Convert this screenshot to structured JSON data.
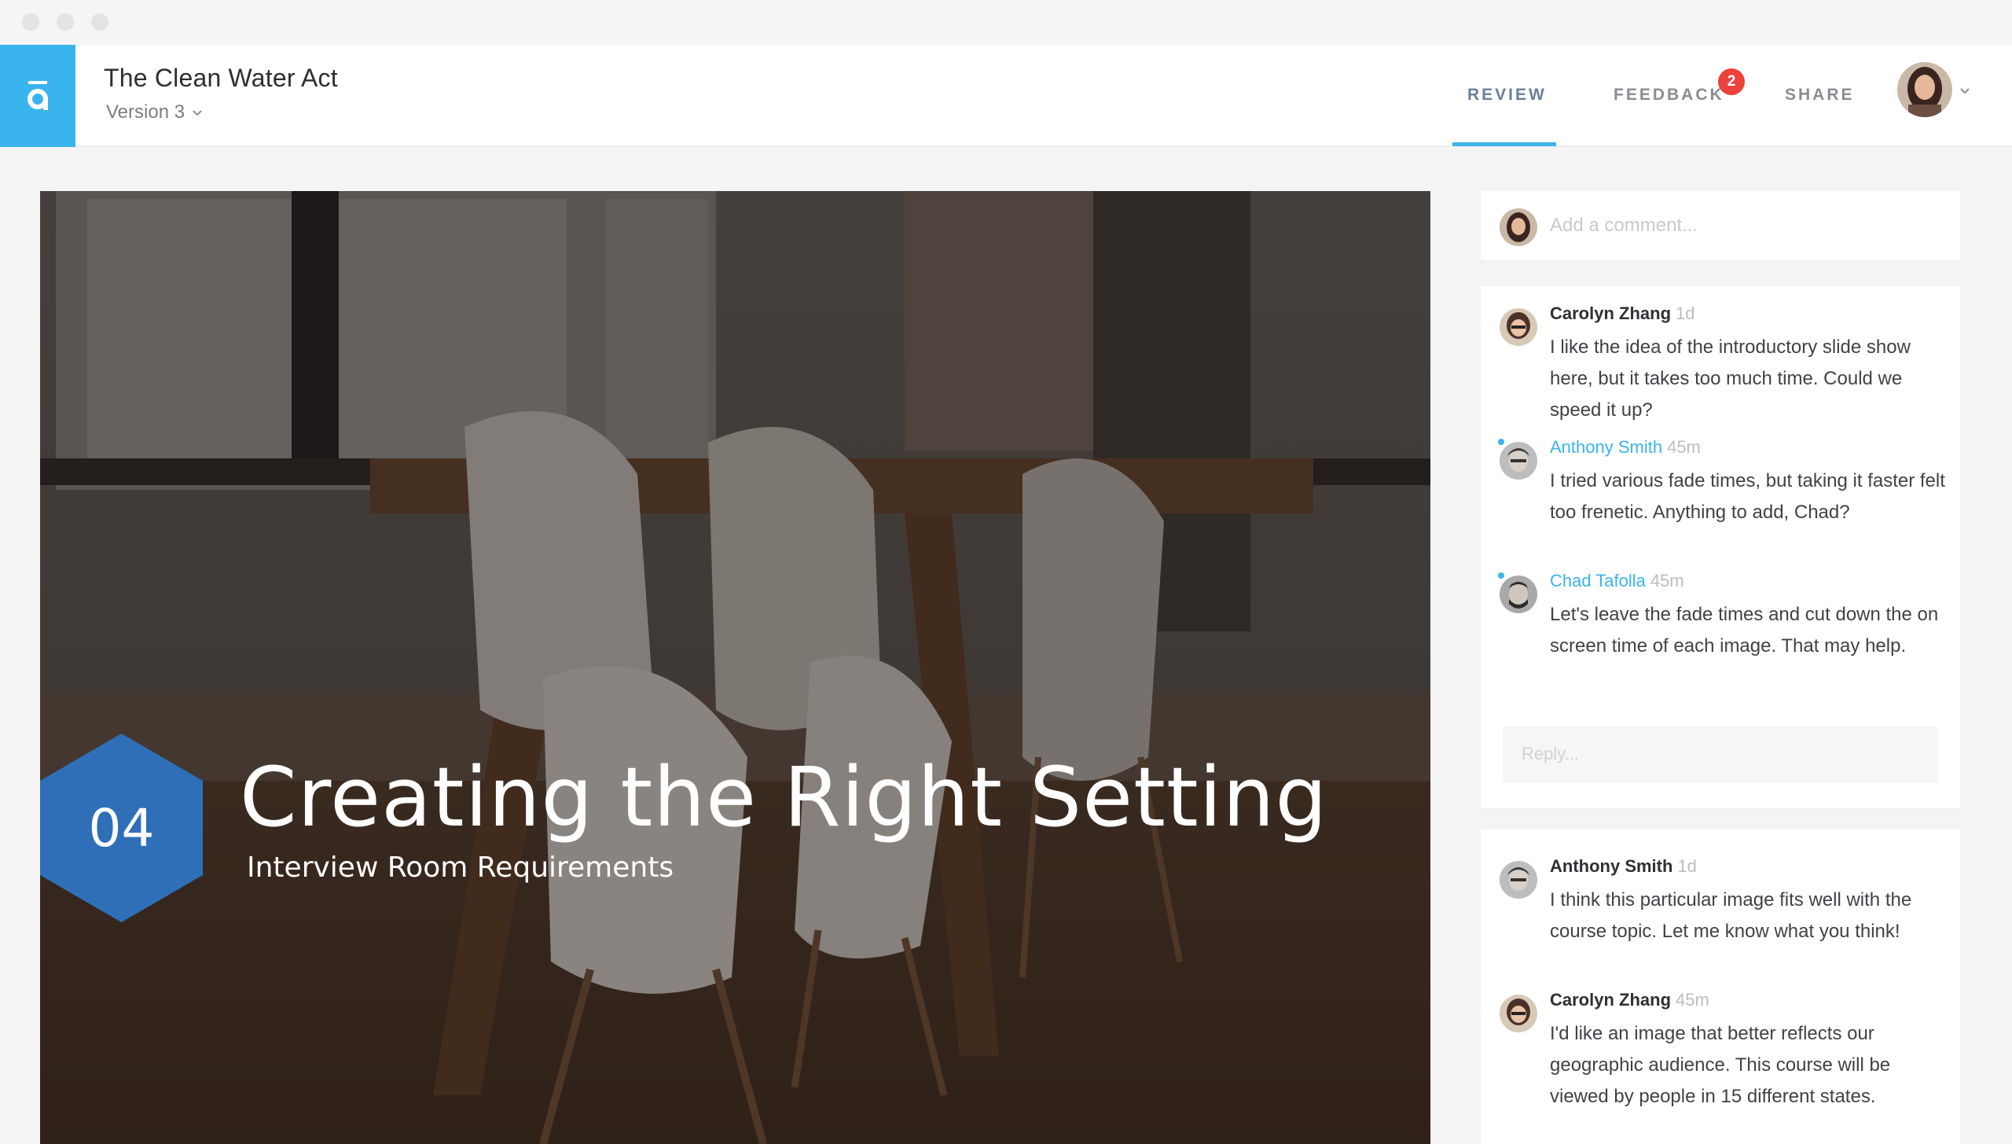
{
  "header": {
    "title": "The Clean Water Act",
    "version_label": "Version 3",
    "tabs": [
      {
        "label": "REVIEW",
        "active": true
      },
      {
        "label": "FEEDBACK",
        "badge": "2"
      },
      {
        "label": "SHARE"
      }
    ]
  },
  "slide": {
    "number": "04",
    "title": "Creating the Right Setting",
    "subtitle": "Interview Room Requirements"
  },
  "composer": {
    "placeholder": "Add a comment..."
  },
  "threads": [
    {
      "comments": [
        {
          "author": "Carolyn Zhang",
          "time": "1d",
          "text": "I like the idea of the introductory slide show here, but it takes too much time. Could we speed it up?"
        },
        {
          "author": "Anthony Smith",
          "time": "45m",
          "text": "I tried various fade times, but taking it faster felt too frenetic. Anything to add, Chad?"
        },
        {
          "author": "Chad Tafolla",
          "time": "45m",
          "text": "Let's leave the fade times and cut down the on screen time of each image. That may help."
        }
      ],
      "reply_placeholder": "Reply..."
    },
    {
      "comments": [
        {
          "author": "Anthony Smith",
          "time": "1d",
          "text": "I think this particular image fits well with the course topic. Let me know what you think!"
        },
        {
          "author": "Carolyn Zhang",
          "time": "45m",
          "text": "I'd like an image that better reflects our geographic audience. This course will be viewed by people in 15 different states."
        }
      ]
    }
  ],
  "colors": {
    "accent": "#3ab4ec",
    "badge": "#e9433c",
    "hexagon": "#2f6fb8"
  },
  "icons": [
    "app-logo-icon",
    "chevron-down-icon"
  ]
}
